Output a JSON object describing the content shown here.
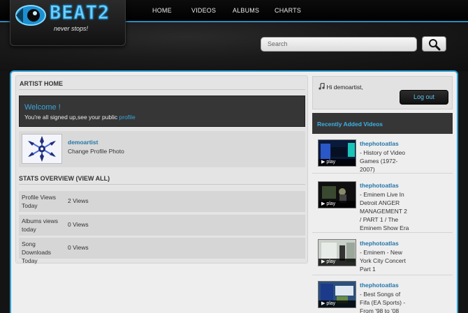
{
  "brand": {
    "logo_text": "BEAT2",
    "tagline": "never stops!",
    "accent": "#2d9fd6"
  },
  "nav": [
    "HOME",
    "VIDEOS",
    "ALBUMS",
    "CHARTS"
  ],
  "search": {
    "placeholder": "Search",
    "button_icon": "magnifier-icon"
  },
  "artist": {
    "section_title": "ARTIST HOME",
    "welcome_title": "Welcome !",
    "welcome_text": "You're all signed up,see your public ",
    "welcome_link": "profile",
    "username": "demoartist",
    "change_photo": "Change Profile Photo",
    "stats_title": "STATS OVERVIEW (VIEW ALL)",
    "stats": [
      {
        "label": "Profile Views Today",
        "value": "2 Views"
      },
      {
        "label": "Albums views today",
        "value": "0 Views"
      },
      {
        "label": "Song Downloads Today",
        "value": "0 Views"
      }
    ]
  },
  "user_box": {
    "greeting": "Hi demoartist,",
    "logout": "Log out"
  },
  "recent": {
    "title": "Recently Added Videos",
    "play_label": "▶ play",
    "videos": [
      {
        "author": "thephotoatlas",
        "title": "- History of Video Games (1972-2007)"
      },
      {
        "author": "thephotoatlas",
        "title": "- Eminem Live In Detroit ANGER MANAGEMENT 2 / PART 1 / The Eminem Show Era"
      },
      {
        "author": "thephotoatlas",
        "title": "- Eminem - New York City Concert Part 1"
      },
      {
        "author": "thephotoatlas",
        "title": "- Best Songs of Fifa (EA Sports) - From '98 to '08"
      }
    ]
  }
}
